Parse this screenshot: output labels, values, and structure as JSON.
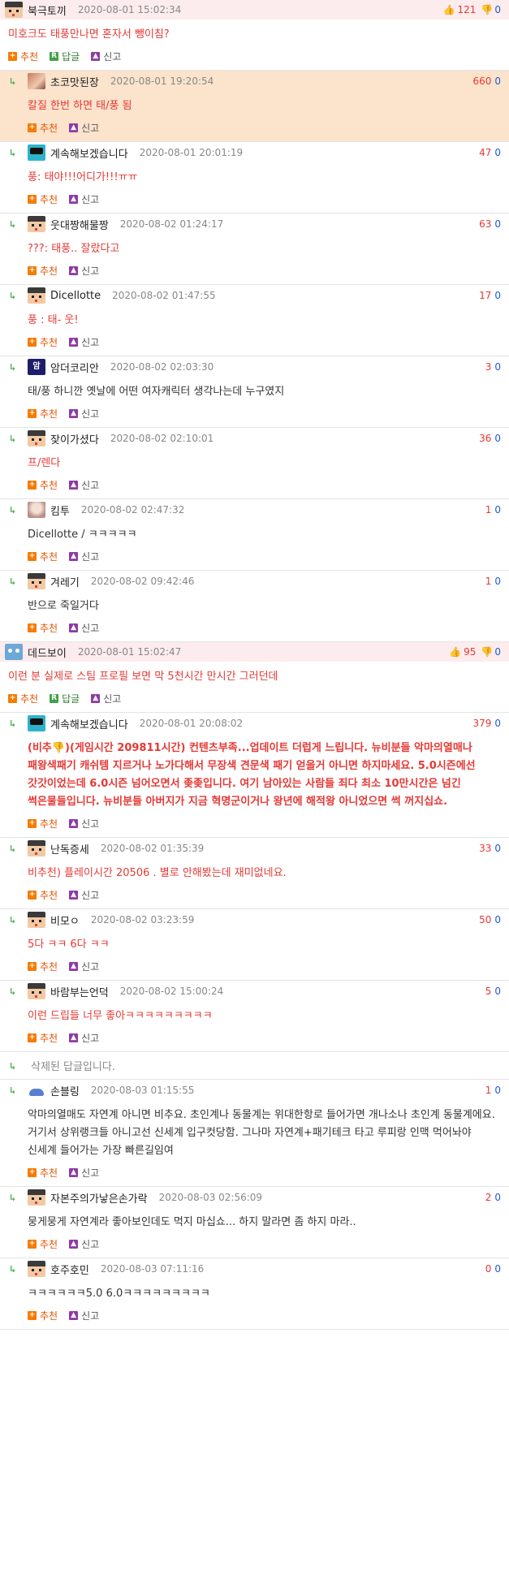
{
  "labels": {
    "recommend": "추천",
    "reply": "답글",
    "report": "신고"
  },
  "threads": [
    {
      "top": {
        "nick": "북극토끼",
        "time": "2020-08-01 15:02:34",
        "up": "121",
        "down": "0",
        "avatar": "pixel-avatar",
        "body": "미호크도 태풍만나면 혼자서 뺑이침?"
      },
      "replies": [
        {
          "nick": "초코맛된장",
          "time": "2020-08-01 19:20:54",
          "score": "660",
          "down": "0",
          "avatar": "girl-avatar",
          "best": true,
          "body": "칼질 한번 하면 태/풍 됨"
        },
        {
          "nick": "계속해보겠습니다",
          "time": "2020-08-01 20:01:19",
          "score": "47",
          "down": "0",
          "avatar": "cyan-avatar",
          "body": "풍: 태야!!!어디가!!!ㅠㅠ"
        },
        {
          "nick": "웃대짱해물짱",
          "time": "2020-08-02 01:24:17",
          "score": "63",
          "down": "0",
          "avatar": "pixel-avatar",
          "body": "???: 태풍.. 잘랐다고"
        },
        {
          "nick": "Dicellotte",
          "time": "2020-08-02 01:47:55",
          "score": "17",
          "down": "0",
          "avatar": "pixel-avatar",
          "body": "풍 : 태- 웃!"
        },
        {
          "nick": "암더코리안",
          "time": "2020-08-02 02:03:30",
          "score": "3",
          "down": "0",
          "avatar": "dark-avatar",
          "body": "태/풍 하니깐 옛날에 어떤 여자캐릭터 생각나는데 누구였지"
        },
        {
          "nick": "잦이가셨다",
          "time": "2020-08-02 02:10:01",
          "score": "36",
          "down": "0",
          "avatar": "pixel-avatar",
          "body": "프/렌다"
        },
        {
          "nick": "킴투",
          "time": "2020-08-02 02:47:32",
          "score": "1",
          "down": "0",
          "avatar": "lady-avatar",
          "body": "Dicellotte / ㅋㅋㅋㅋㅋ"
        },
        {
          "nick": "겨레기",
          "time": "2020-08-02 09:42:46",
          "score": "1",
          "down": "0",
          "avatar": "pixel-avatar",
          "body": "반으로 죽일거다"
        }
      ]
    },
    {
      "top": {
        "nick": "데드보이",
        "time": "2020-08-01 15:02:47",
        "up": "95",
        "down": "0",
        "avatar": "cat-avatar",
        "body": "이런 분 실제로 스팀 프로필 보면 막 5천시간 만시간 그러던데"
      },
      "replies": [
        {
          "nick": "계속해보겠습니다",
          "time": "2020-08-01 20:08:02",
          "score": "379",
          "down": "0",
          "avatar": "cyan-avatar",
          "body": "(비추👎)(게임시간 209811시간) 컨텐츠부족...업데이트 더럽게 느립니다. 뉴비분들 악마의열매나 패왕색패기 캐쉬템 지르거나 노가다해서 무장색 견문색 패기 얻을거 아니면 하지마세요. 5.0시즌에선 갓갓이었는데 6.0시즌 넘어오면서 좆좆입니다. 여기 남아있는 사람들 죄다 최소 10만시간은 넘긴 썩은물들입니다. 뉴비분들 아버지가 지금 혁명군이거나 왕년에 해적왕 아니었으면 썩 꺼지십쇼."
        },
        {
          "nick": "난독증세",
          "time": "2020-08-02 01:35:39",
          "score": "33",
          "down": "0",
          "avatar": "pixel-avatar",
          "body": "비추천) 플레이시간 20506 . 별로 안해봤는데 재미없네요."
        },
        {
          "nick": "비모ㅇ",
          "time": "2020-08-02 03:23:59",
          "score": "50",
          "down": "0",
          "avatar": "pixel-avatar",
          "body": "5다 ㅋㅋ 6다 ㅋㅋ"
        },
        {
          "nick": "바람부는언덕",
          "time": "2020-08-02 15:00:24",
          "score": "5",
          "down": "0",
          "avatar": "pixel-avatar",
          "body": "이런 드립들 너무 좋아ㅋㅋㅋㅋㅋㅋㅋㅋㅋ"
        }
      ],
      "deleted": "삭제된 답글입니다.",
      "replies2": [
        {
          "nick": "손블링",
          "time": "2020-08-03 01:15:55",
          "score": "1",
          "down": "0",
          "avatar": "cloud-avatar",
          "body": "악마의열매도 자연계 아니면 비추요. 초인계나 동물계는 위대한항로 들어가면 개나소나 초인계 동물계에요. 거기서 상위랭크들 아니고선 신세계 입구컷당함. 그나마 자연계+패기테크 타고 루피랑 인맥 먹어놔야 신세계 들어가는 가장 빠른길임여"
        },
        {
          "nick": "자본주의가낳은손가락",
          "time": "2020-08-03 02:56:09",
          "score": "2",
          "down": "0",
          "avatar": "pixel-avatar",
          "body": "뭉게뭉게 자연계라 좋아보인데도 먹지 마십쇼... 하지 말라면 좀 하지 마라.."
        },
        {
          "nick": "호주호민",
          "time": "2020-08-03 07:11:16",
          "score": "0",
          "down": "0",
          "avatar": "pixel-avatar",
          "body": "ㅋㅋㅋㅋㅋㅋ5.0 6.0ㅋㅋㅋㅋㅋㅋㅋㅋㅋ"
        }
      ]
    }
  ]
}
